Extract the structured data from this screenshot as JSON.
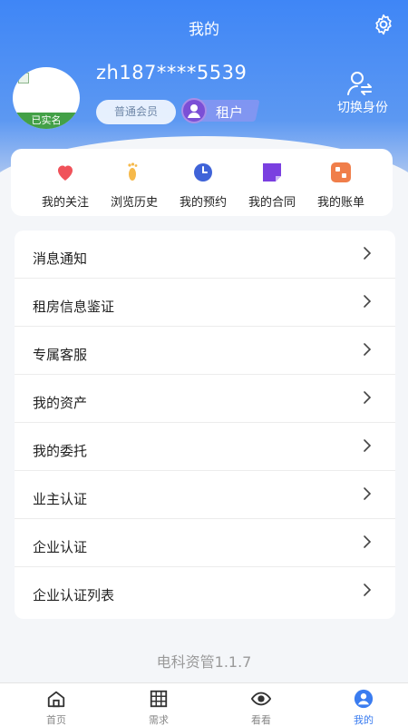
{
  "header": {
    "title": "我的",
    "settings_icon": "gear-icon"
  },
  "profile": {
    "username": "zh187****5539",
    "verified_label": "已实名",
    "member_level": "普通会员",
    "role": "租户",
    "switch_identity_label": "切换身份"
  },
  "quick_actions": [
    {
      "label": "我的关注",
      "icon": "heart-icon",
      "color": "#f0525a"
    },
    {
      "label": "浏览历史",
      "icon": "footprint-icon",
      "color": "#f6b94a"
    },
    {
      "label": "我的预约",
      "icon": "clock-icon",
      "color": "#3f63d8"
    },
    {
      "label": "我的合同",
      "icon": "contract-icon",
      "color": "#7a3fe0"
    },
    {
      "label": "我的账单",
      "icon": "bill-icon",
      "color": "#f07e4a"
    }
  ],
  "menu": [
    {
      "label": "消息通知"
    },
    {
      "label": "租房信息鉴证"
    },
    {
      "label": "专属客服"
    },
    {
      "label": "我的资产"
    },
    {
      "label": "我的委托"
    },
    {
      "label": "业主认证"
    },
    {
      "label": "企业认证"
    },
    {
      "label": "企业认证列表"
    }
  ],
  "version": "电科资管1.1.7",
  "tabs": [
    {
      "label": "首页",
      "icon": "home-icon",
      "active": false
    },
    {
      "label": "需求",
      "icon": "grid-icon",
      "active": false
    },
    {
      "label": "看看",
      "icon": "eye-icon",
      "active": false
    },
    {
      "label": "我的",
      "icon": "user-icon",
      "active": true
    }
  ],
  "colors": {
    "primary": "#3f86f6",
    "tab_active": "#3a7cf0",
    "verified": "#43a047"
  }
}
